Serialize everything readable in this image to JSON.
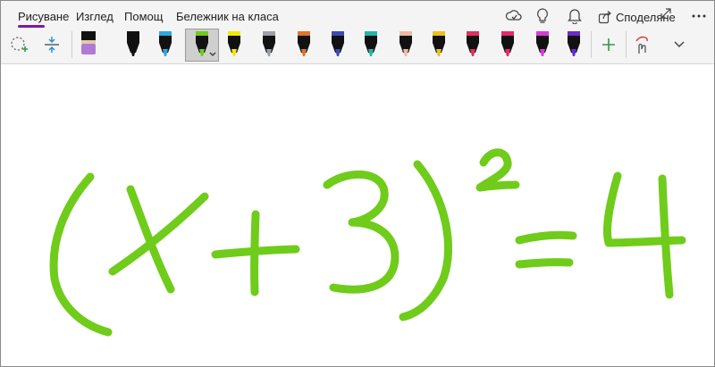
{
  "tabs": [
    {
      "label": "Рисуване",
      "active": true
    },
    {
      "label": "Изглед",
      "active": false
    },
    {
      "label": "Помощ",
      "active": false
    },
    {
      "label": "Бележник на класа",
      "active": false
    }
  ],
  "header": {
    "share_label": "Споделяне"
  },
  "pens": [
    {
      "name": "pen-purple-highlighter",
      "color": "#b179d6",
      "tip": "#e7c8a8"
    },
    {
      "name": "pen-black",
      "color": "#111111",
      "tip": "#ffffff"
    },
    {
      "name": "pen-blue",
      "color": "#2aa8e0",
      "tip": "#ffffff"
    },
    {
      "name": "pen-green-selected",
      "color": "#6fcc1a",
      "tip": "#6fcc1a"
    },
    {
      "name": "pen-yellow-highlighter",
      "color": "#f5e800",
      "tip": "#f5e800"
    },
    {
      "name": "pen-silver",
      "color": "#9aa0a6",
      "tip": "#9aa0a6"
    },
    {
      "name": "pen-rainbow",
      "color": "#e0742c",
      "tip": "#5db23b"
    },
    {
      "name": "pen-galaxy",
      "color": "#3a4bb6",
      "tip": "#c44bd6"
    },
    {
      "name": "pen-teal",
      "color": "#23b5a8",
      "tip": "#23b5a8"
    },
    {
      "name": "pen-peach",
      "color": "#f0b8a0",
      "tip": "#f0b8a0"
    },
    {
      "name": "pen-gold",
      "color": "#e8c21a",
      "tip": "#e8a21a"
    },
    {
      "name": "pen-pink-red",
      "color": "#e03060",
      "tip": "#e03060"
    },
    {
      "name": "pen-hot-pink",
      "color": "#e6286e",
      "tip": "#e6286e"
    },
    {
      "name": "pen-magenta-highlighter",
      "color": "#d83ad8",
      "tip": "#d83ad8"
    },
    {
      "name": "pen-violet",
      "color": "#6a2bd0",
      "tip": "#6a2bd0"
    }
  ],
  "colors": {
    "accent": "#7719aa",
    "ink": "#6fcc1a"
  }
}
